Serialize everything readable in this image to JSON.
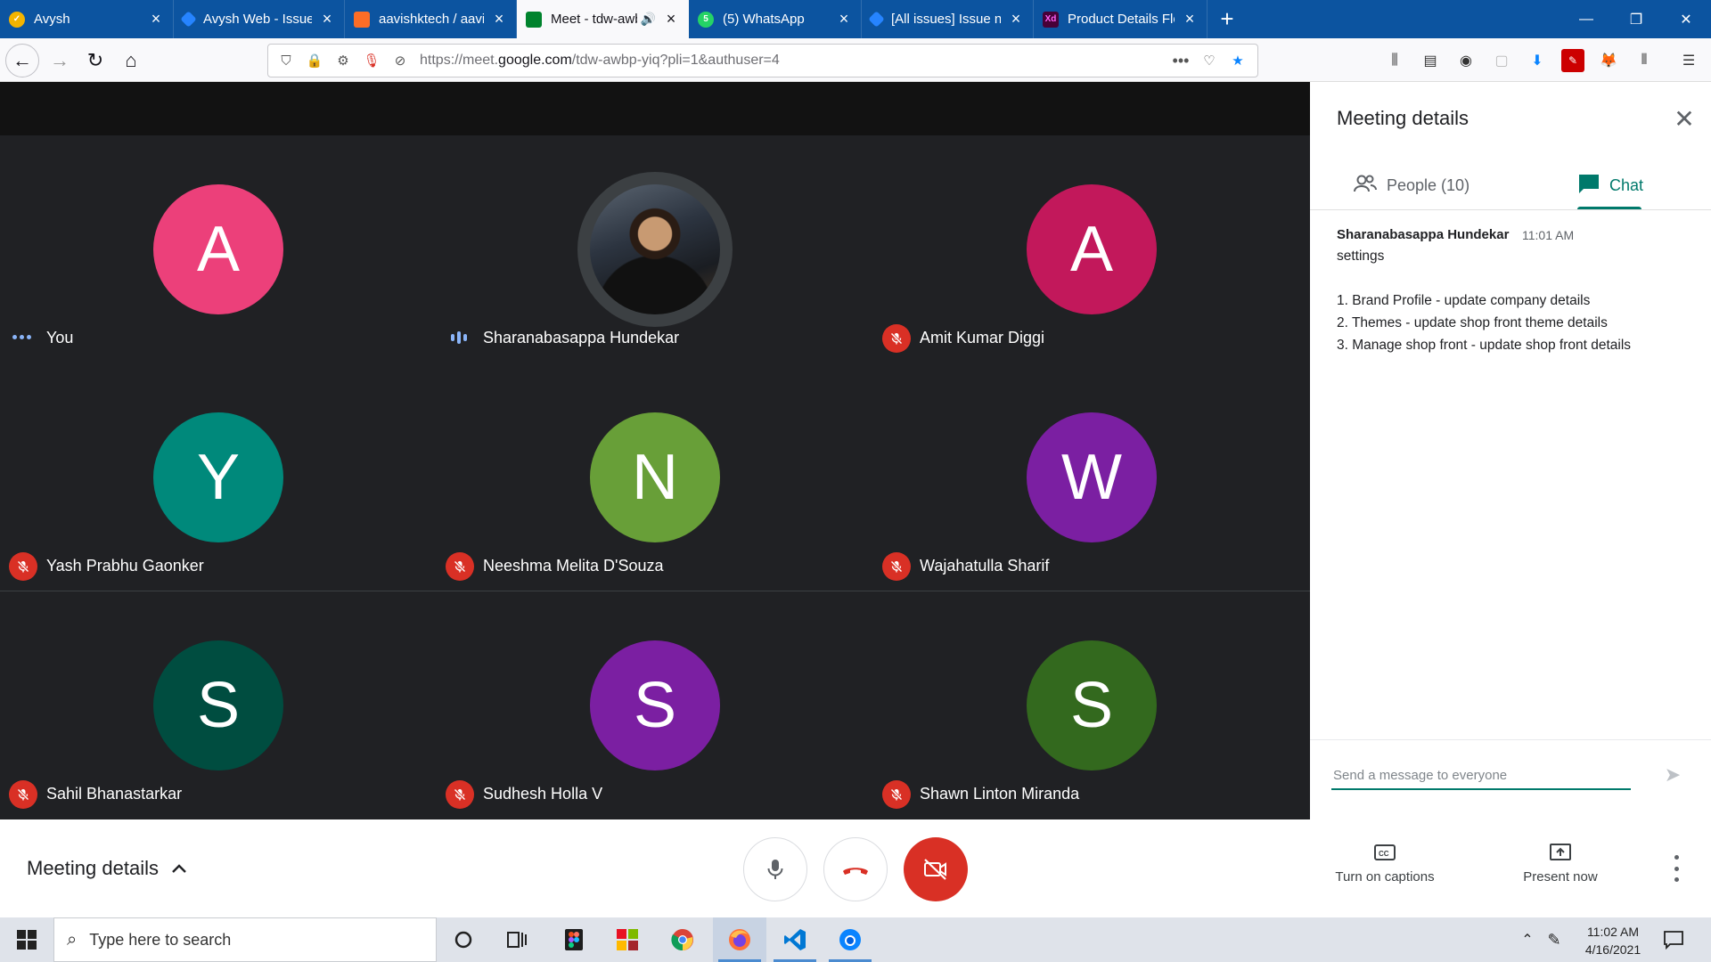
{
  "browser": {
    "tabs": [
      {
        "title": "Avysh",
        "favicon": "avysh-logo-icon",
        "favicon_color": "#f4b400"
      },
      {
        "title": "Avysh Web - Issues - Jira",
        "favicon": "jira-icon",
        "favicon_color": "#2684ff"
      },
      {
        "title": "aavishktech / aavishk-ch",
        "favicon": "gitlab-icon",
        "favicon_color": "#fc6d26"
      },
      {
        "title": "Meet - tdw-awbp-yiq",
        "favicon": "google-meet-icon",
        "favicon_color": "#00832d",
        "active": true,
        "audio": true
      },
      {
        "title": "(5) WhatsApp",
        "favicon": "whatsapp-icon",
        "favicon_color": "#25d366",
        "badge": "5"
      },
      {
        "title": "[All issues] Issue navigat",
        "favicon": "jira-icon",
        "favicon_color": "#2684ff"
      },
      {
        "title": "Product Details Flow",
        "favicon": "adobe-xd-icon",
        "favicon_color": "#470137",
        "favicon_text": "Xd"
      }
    ],
    "url_prefix": "https://meet.",
    "url_domain": "google.com",
    "url_path": "/tdw-awbp-yiq?pli=1&authuser=4"
  },
  "meet": {
    "participants": [
      {
        "initial": "A",
        "name": "You",
        "color": "#ec407a",
        "status": "speaking-dots"
      },
      {
        "initial": "",
        "name": "Sharanabasappa Hundekar",
        "color": "#3c4043",
        "status": "speaking-bars",
        "photo": true
      },
      {
        "initial": "A",
        "name": "Amit Kumar Diggi",
        "color": "#c2185b",
        "status": "muted"
      },
      {
        "initial": "Y",
        "name": "Yash Prabhu Gaonker",
        "color": "#00897b",
        "status": "muted"
      },
      {
        "initial": "N",
        "name": "Neeshma Melita D'Souza",
        "color": "#689f38",
        "status": "muted"
      },
      {
        "initial": "W",
        "name": "Wajahatulla Sharif",
        "color": "#7b1fa2",
        "status": "muted"
      },
      {
        "initial": "S",
        "name": "Sahil Bhanastarkar",
        "color": "#004d40",
        "status": "muted"
      },
      {
        "initial": "S",
        "name": "Sudhesh Holla V",
        "color": "#7b1fa2",
        "status": "muted"
      },
      {
        "initial": "S",
        "name": "Shawn Linton Miranda",
        "color": "#33691e",
        "status": "muted"
      }
    ],
    "panel": {
      "title": "Meeting details",
      "people_tab": "People (10)",
      "chat_tab": "Chat",
      "message": {
        "sender": "Sharanabasappa Hundekar",
        "time": "11:01 AM",
        "lines": [
          "settings",
          "",
          "1. Brand Profile - update company details",
          "2. Themes - update shop front theme details",
          "3. Manage shop front - update shop front details"
        ]
      },
      "composer_placeholder": "Send a message to everyone"
    },
    "controls": {
      "meeting_details_label": "Meeting details",
      "captions_label": "Turn on captions",
      "present_label": "Present now"
    }
  },
  "taskbar": {
    "search_placeholder": "Type here to search",
    "time": "11:02 AM",
    "date": "4/16/2021"
  }
}
